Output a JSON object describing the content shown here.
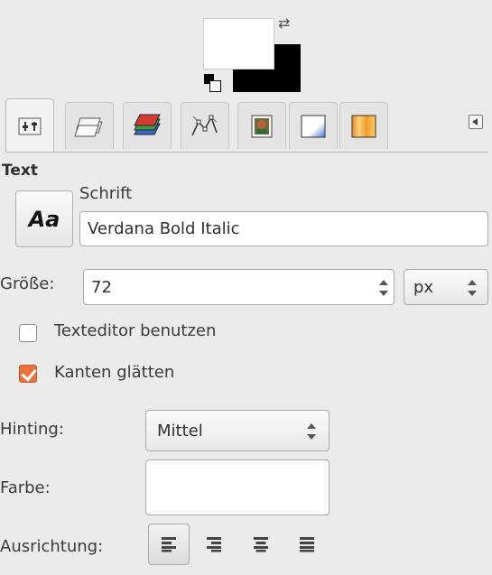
{
  "colors": {
    "foreground": "#ffffff",
    "background": "#000000",
    "accent_checkbox": "#e7743f"
  },
  "tabs": [
    {
      "name": "tool-options-icon"
    },
    {
      "name": "layers-icon"
    },
    {
      "name": "channels-icon"
    },
    {
      "name": "paths-icon"
    },
    {
      "name": "image-thumbnail-icon"
    },
    {
      "name": "gradient-white-icon"
    },
    {
      "name": "gradient-orange-icon"
    }
  ],
  "panel": {
    "title": "Text",
    "font": {
      "button_label": "Aa",
      "label": "Schrift",
      "value": "Verdana Bold Italic"
    },
    "size": {
      "label": "Größe:",
      "value": "72",
      "unit": "px"
    },
    "use_editor": {
      "label": "Texteditor benutzen",
      "checked": false
    },
    "antialias": {
      "label": "Kanten glätten",
      "checked": true
    },
    "hinting": {
      "label": "Hinting:",
      "value": "Mittel"
    },
    "color": {
      "label": "Farbe:",
      "value": "#ffffff"
    },
    "justify": {
      "label": "Ausrichtung:",
      "options": [
        "left",
        "right",
        "center",
        "fill"
      ],
      "selected": "left"
    }
  }
}
